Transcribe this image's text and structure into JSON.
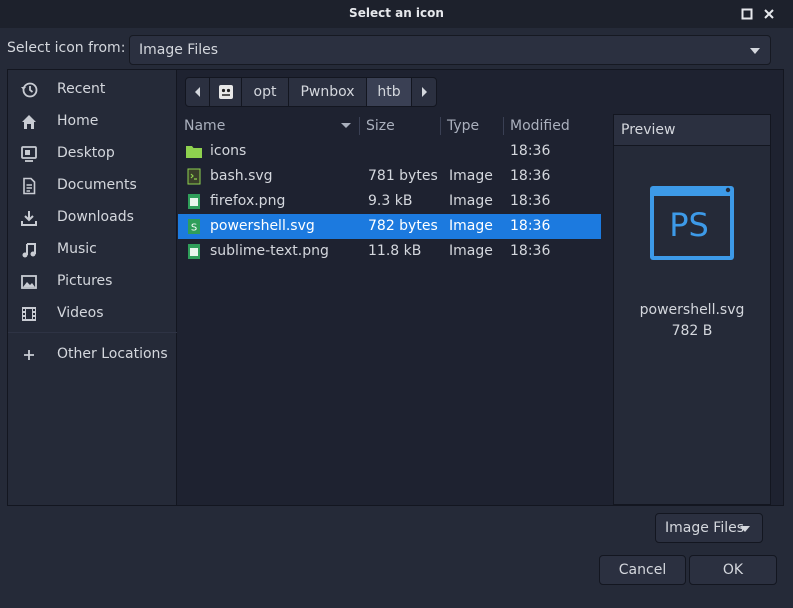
{
  "window": {
    "title": "Select an icon"
  },
  "source": {
    "label": "Select icon from:",
    "value": "Image Files"
  },
  "sidebar": {
    "items": [
      {
        "label": "Recent",
        "icon": "clock-icon"
      },
      {
        "label": "Home",
        "icon": "home-icon"
      },
      {
        "label": "Desktop",
        "icon": "desktop-icon"
      },
      {
        "label": "Documents",
        "icon": "document-icon"
      },
      {
        "label": "Downloads",
        "icon": "download-icon"
      },
      {
        "label": "Music",
        "icon": "music-note-icon"
      },
      {
        "label": "Pictures",
        "icon": "picture-icon"
      },
      {
        "label": "Videos",
        "icon": "film-icon"
      }
    ],
    "other": {
      "label": "Other Locations",
      "icon": "plus-icon"
    }
  },
  "path": {
    "segments": [
      "opt",
      "Pwnbox",
      "htb"
    ],
    "active": "htb"
  },
  "columns": {
    "name": "Name",
    "size": "Size",
    "type": "Type",
    "modified": "Modified"
  },
  "files": [
    {
      "name": "icons",
      "size": "",
      "type": "",
      "modified": "18:36",
      "icon": "folder-icon"
    },
    {
      "name": "bash.svg",
      "size": "781 bytes",
      "type": "Image",
      "modified": "18:36",
      "icon": "svg-file-icon"
    },
    {
      "name": "firefox.png",
      "size": "9.3 kB",
      "type": "Image",
      "modified": "18:36",
      "icon": "png-file-icon"
    },
    {
      "name": "powershell.svg",
      "size": "782 bytes",
      "type": "Image",
      "modified": "18:36",
      "icon": "svg-file-icon",
      "selected": true
    },
    {
      "name": "sublime-text.png",
      "size": "11.8 kB",
      "type": "Image",
      "modified": "18:36",
      "icon": "png-file-icon"
    }
  ],
  "preview": {
    "title": "Preview",
    "filename": "powershell.svg",
    "size": "782 B",
    "icon_text": "PS"
  },
  "filter": {
    "value": "Image Files"
  },
  "buttons": {
    "cancel": "Cancel",
    "ok": "OK"
  },
  "colors": {
    "accent": "#1c7adf",
    "folder": "#8fd14f",
    "ps_blue": "#3d9ae8"
  }
}
